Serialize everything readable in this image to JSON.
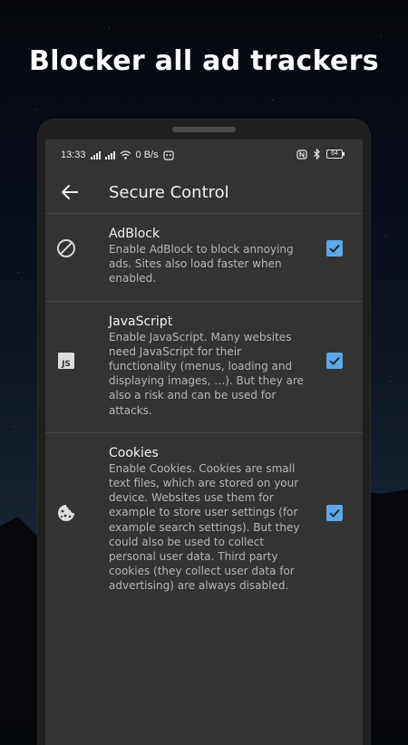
{
  "headline": "Blocker all ad trackers",
  "status_bar": {
    "time": "13:33",
    "network_speed": "0 B/s",
    "battery": "64"
  },
  "app_bar": {
    "title": "Secure Control",
    "back_icon": "arrow-left-icon"
  },
  "settings": [
    {
      "icon": "block-icon",
      "title": "AdBlock",
      "description": "Enable AdBlock to block annoying ads. Sites also load faster when enabled.",
      "checked": true
    },
    {
      "icon": "javascript-icon",
      "title": "JavaScript",
      "description": "Enable JavaScript. Many websites need JavaScript for their functionality (menus, loading and displaying images, …). But they are also a risk and can be used for attacks.",
      "checked": true
    },
    {
      "icon": "cookie-icon",
      "title": "Cookies",
      "description": "Enable Cookies. Cookies are small text files, which are stored on your device. Websites use them for example to store user settings (for example search settings). But they could also be used to collect personal user data. Third party cookies (they collect user data for advertising) are always disabled.",
      "checked": true
    }
  ],
  "colors": {
    "checkbox": "#5ba8ea",
    "screen_bg": "#333333"
  }
}
